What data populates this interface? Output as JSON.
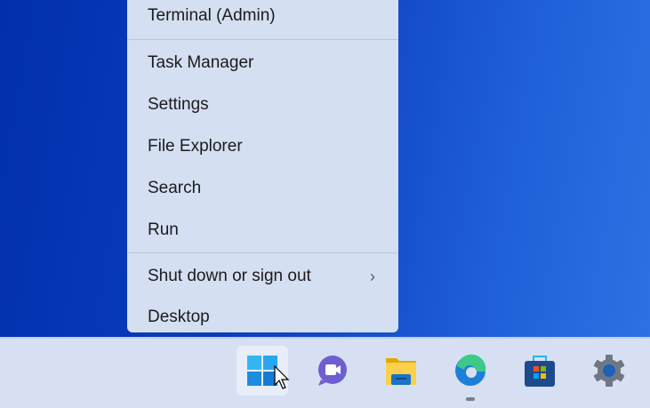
{
  "menu": {
    "items": [
      {
        "label": "Terminal (Admin)"
      },
      {
        "label": "Task Manager"
      },
      {
        "label": "Settings"
      },
      {
        "label": "File Explorer"
      },
      {
        "label": "Search"
      },
      {
        "label": "Run"
      },
      {
        "label": "Shut down or sign out",
        "submenu": "›"
      },
      {
        "label": "Desktop"
      }
    ]
  },
  "taskbar": {
    "icons": [
      "windows-start-icon",
      "teams-chat-icon",
      "file-explorer-icon",
      "edge-icon",
      "microsoft-store-icon",
      "settings-gear-icon"
    ]
  }
}
